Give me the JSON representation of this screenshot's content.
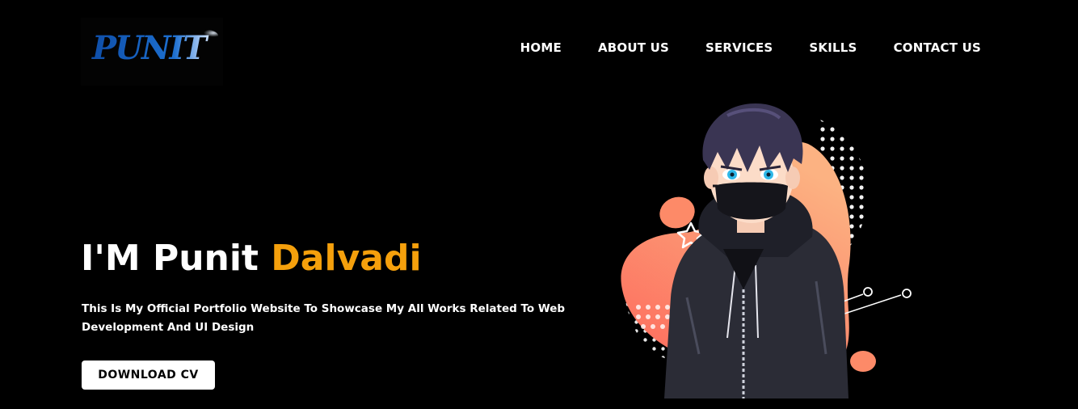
{
  "header": {
    "logo_text": "PUNIT"
  },
  "nav": {
    "items": [
      {
        "id": "home",
        "label": "HOME"
      },
      {
        "id": "about",
        "label": "ABOUT US"
      },
      {
        "id": "services",
        "label": "SERVICES"
      },
      {
        "id": "skills",
        "label": "SKILLS"
      },
      {
        "id": "contact",
        "label": "CONTACT US"
      }
    ]
  },
  "hero": {
    "title_prefix": "I'M Punit ",
    "title_accent": "Dalvadi",
    "subtitle": "This Is My Official Portfolio Website To Showcase My All Works Related To Web Development And UI Design",
    "cta_label": "DOWNLOAD CV"
  },
  "colors": {
    "background": "#000000",
    "accent": "#f5a00c",
    "logo_blue": "#1a5fb4",
    "blob_orange": "#fd8a68",
    "blob_peach": "#fcb282",
    "hoodie": "#2b2c36"
  }
}
